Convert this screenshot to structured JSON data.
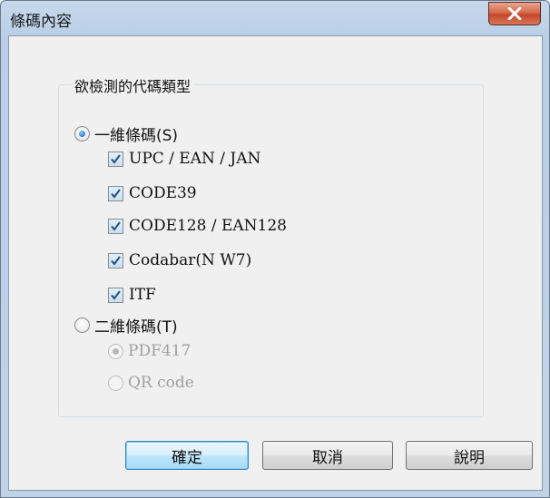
{
  "window": {
    "title": "條碼內容"
  },
  "group": {
    "legend": "欲檢測的代碼類型",
    "one_d": {
      "label": "一維條碼(S)",
      "selected": true,
      "items": [
        {
          "label": "UPC / EAN / JAN",
          "checked": true
        },
        {
          "label": "CODE39",
          "checked": true
        },
        {
          "label": "CODE128 / EAN128",
          "checked": true
        },
        {
          "label": "Codabar(N W7)",
          "checked": true
        },
        {
          "label": "ITF",
          "checked": true
        }
      ]
    },
    "two_d": {
      "label": "二維條碼(T)",
      "selected": false,
      "items": [
        {
          "label": "PDF417",
          "selected": true,
          "enabled": false
        },
        {
          "label": "QR code",
          "selected": false,
          "enabled": false
        }
      ]
    }
  },
  "buttons": {
    "ok": "確定",
    "cancel": "取消",
    "help": "說明"
  },
  "icons": {
    "close": "close-icon",
    "check": "checkmark-icon"
  }
}
